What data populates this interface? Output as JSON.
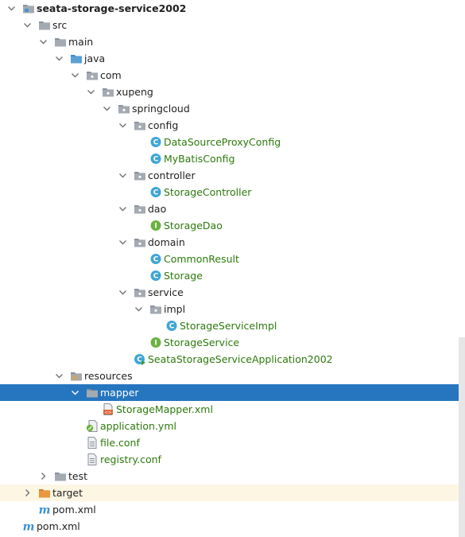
{
  "project_tree": {
    "project_root": "seata-storage-service2002",
    "src": "src",
    "main": "main",
    "java": "java",
    "com": "com",
    "xupeng": "xupeng",
    "springcloud": "springcloud",
    "config": "config",
    "DataSourceProxyConfig": "DataSourceProxyConfig",
    "MyBatisConfig": "MyBatisConfig",
    "controller": "controller",
    "StorageController": "StorageController",
    "dao": "dao",
    "StorageDao": "StorageDao",
    "domain": "domain",
    "CommonResult": "CommonResult",
    "Storage": "Storage",
    "service": "service",
    "impl": "impl",
    "StorageServiceImpl": "StorageServiceImpl",
    "StorageService": "StorageService",
    "SeataStorageServiceApplication2002": "SeataStorageServiceApplication2002",
    "resources": "resources",
    "mapper": "mapper",
    "StorageMapper": "StorageMapper.xml",
    "application_yml": "application.yml",
    "file_conf": "file.conf",
    "registry_conf": "registry.conf",
    "test": "test",
    "target": "target",
    "pom_inner": "pom.xml",
    "pom_root": "pom.xml"
  },
  "colors": {
    "selection": "#2675bf",
    "class_text": "#2b7a0b",
    "class_icon": "#3fa6d6",
    "interface_icon": "#6bb342",
    "folder_gray": "#8a929b",
    "folder_blue": "#5aa1d6",
    "folder_orange": "#e8973a",
    "maven_blue": "#3a8ed6"
  }
}
